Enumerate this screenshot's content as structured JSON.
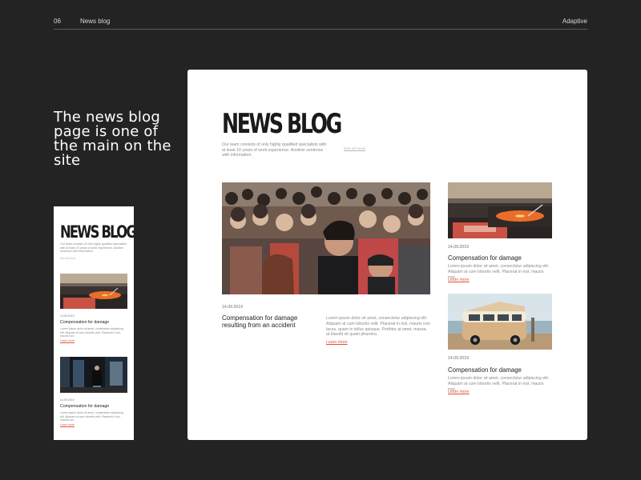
{
  "topbar": {
    "number": "06",
    "section": "News blog",
    "right_label": "Adaptive"
  },
  "headline": "The news blog page is one of the main on the site",
  "desktop": {
    "title": "NEWS BLOG",
    "description": "Our team consists of only highly qualified specialists with at least 10 years of work experience. Another sentence with information.",
    "see_all": "See all news",
    "hero": {
      "image_icon": "crowd-photo",
      "date": "14.09.2019",
      "title": "Compensation for damage resulting from an accident",
      "text": "Lorem ipsum dolor sit amet, consectetur adipiscing elit. Aliquam at cum lobortis velit. Placerat in nisl, mauris non lacus, quam in tellus quisque. Porttitor at amet, massa, at blandit sit quam pharetra.",
      "learn_more": "Learn more"
    },
    "cards": [
      {
        "image_icon": "turntable-photo",
        "date": "14.09.2019",
        "title": "Compensation for damage",
        "text": "Lorem ipsum dolor sit amet, consectetur adipiscing elit. Aliquam at cum lobortis velit. Placerat in nisl, mauris non.",
        "learn_more": "Learn more"
      },
      {
        "image_icon": "camper-van-photo",
        "date": "14.09.2019",
        "title": "Compensation for damage",
        "text": "Lorem ipsum dolor sit amet, consectetur adipiscing elit. Aliquam at cum lobortis velit. Placerat in nisl, mauris non.",
        "learn_more": "Learn more"
      }
    ]
  },
  "mobile": {
    "title": "NEWS BLOG",
    "description": "Our team consists of only highly qualified specialists with at least 10 years of work experience. Another sentence with information.",
    "see_all": "See all news",
    "cards": [
      {
        "image_icon": "turntable-photo",
        "date": "14.09.2019",
        "title": "Compensation for damage",
        "text": "Lorem ipsum dolor sit amet, consectetur adipiscing elit. Aliquam at cum lobortis velit. Placerat in nisl, mauris non.",
        "learn_more": "Learn more"
      },
      {
        "image_icon": "street-photo",
        "date": "14.09.2019",
        "title": "Compensation for damage",
        "text": "Lorem ipsum dolor sit amet, consectetur adipiscing elit. Aliquam at cum lobortis velit. Placerat in nisl, mauris non.",
        "learn_more": "Learn more"
      }
    ]
  },
  "colors": {
    "background": "#232323",
    "card": "#ffffff",
    "accent": "#e0513b"
  }
}
